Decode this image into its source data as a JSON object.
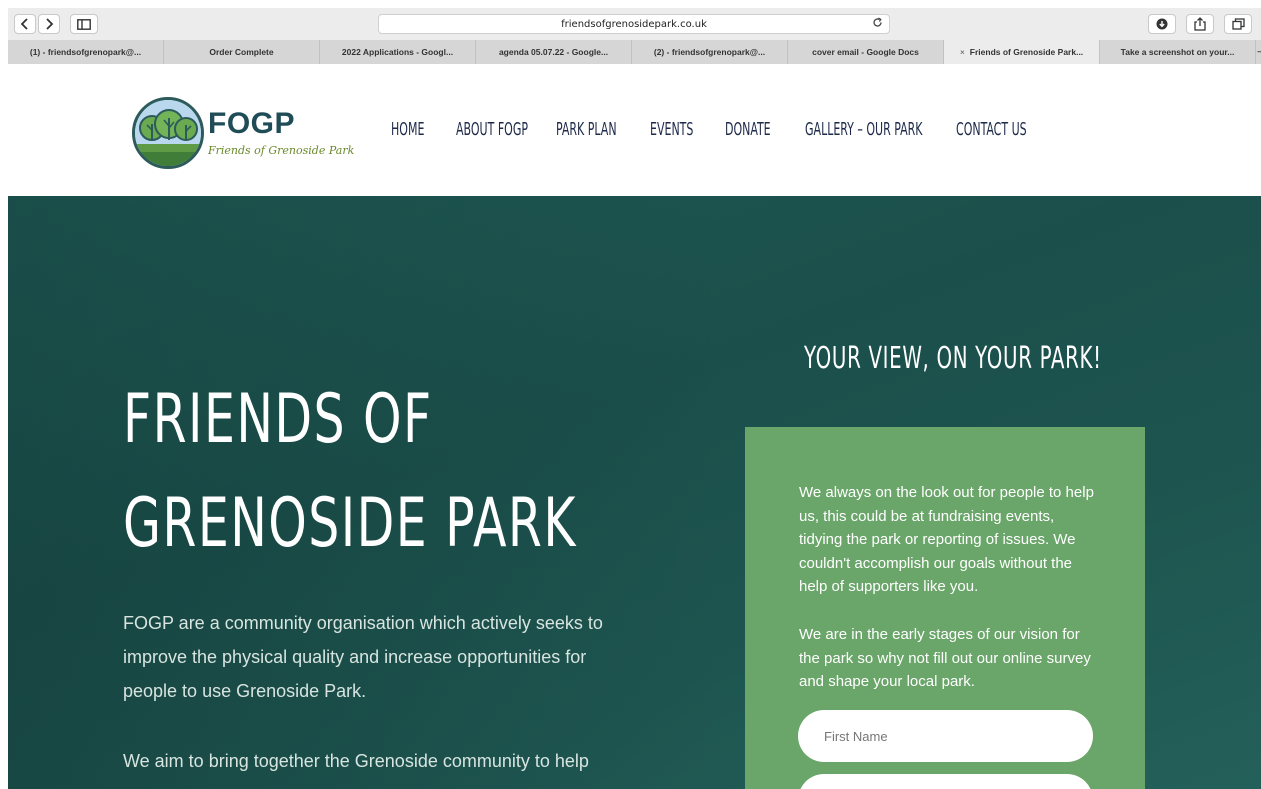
{
  "browser": {
    "url": "friendsofgrenosidepark.co.uk",
    "tabs": [
      {
        "label": "(1) - friendsofgrenopark@...",
        "active": false
      },
      {
        "label": "Order Complete",
        "active": false
      },
      {
        "label": "2022 Applications - Googl...",
        "active": false
      },
      {
        "label": "agenda 05.07.22 - Google...",
        "active": false
      },
      {
        "label": "(2) - friendsofgrenopark@...",
        "active": false
      },
      {
        "label": "cover email - Google Docs",
        "active": false
      },
      {
        "label": "Friends of Grenoside Park...",
        "active": true
      },
      {
        "label": "Take a screenshot on your...",
        "active": false
      }
    ],
    "icons": [
      "back-icon",
      "forward-icon",
      "sidebar-icon",
      "reload-icon",
      "download-icon",
      "share-icon",
      "tabs-overview-icon",
      "new-tab-icon"
    ]
  },
  "header": {
    "logo_title": "FOGP",
    "logo_subtitle": "Friends of Grenoside Park",
    "nav": [
      "Home",
      "About FOGP",
      "Park Plan",
      "Events",
      "Donate",
      "Gallery – Our Park",
      "Contact Us"
    ]
  },
  "hero": {
    "title_line1": "Friends of",
    "title_line2": "Grenoside Park",
    "paragraph1": "FOGP are a community organisation which actively seeks to improve the physical quality and increase opportunities for people to use Grenoside Park.",
    "paragraph2": "We aim to bring together the Grenoside community to help"
  },
  "panel": {
    "heading": "Your view, on your park!",
    "text1": "We always on the look out for people to help us, this could be at fundraising events, tidying the park or reporting of issues. We couldn't accomplish our goals without the help of supporters like you.",
    "text2": "We are in the early stages of our vision for the park so why not fill out our online survey and shape your local park.",
    "first_name_placeholder": "First Name",
    "second_field_placeholder": ""
  },
  "colors": {
    "hero_bg": "#1f5a55",
    "panel_bg": "#6aa56a",
    "nav_text": "#1e2a4a",
    "logo_text": "#1f4c57"
  }
}
